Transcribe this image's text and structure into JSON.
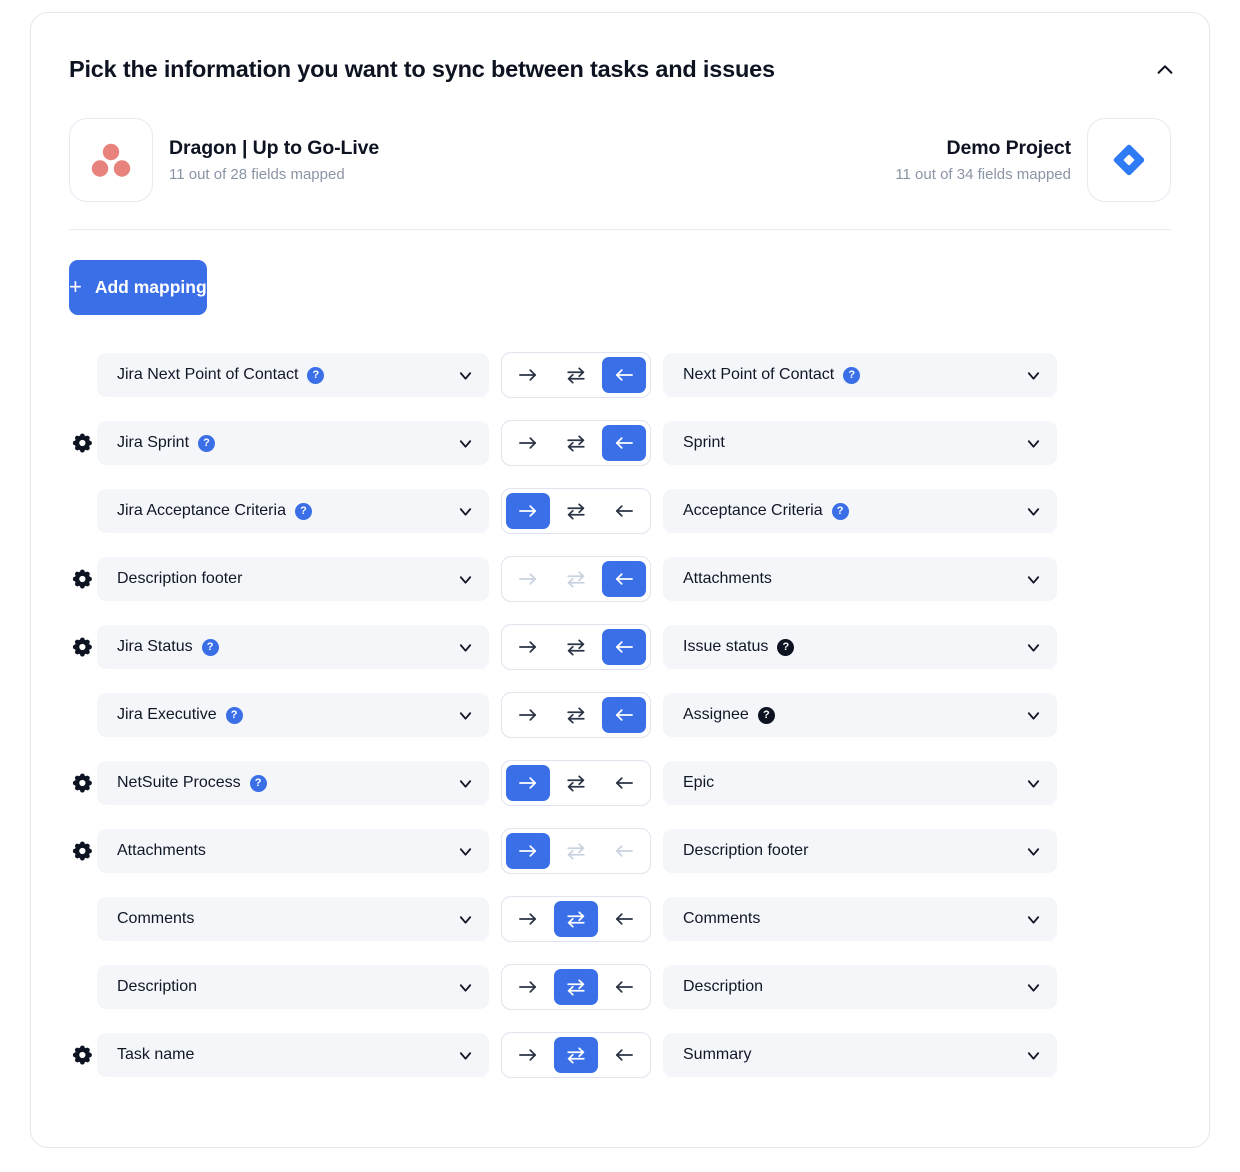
{
  "header": {
    "title": "Pick the information you want to sync between tasks and issues",
    "collapse_icon": "chevron-up-icon"
  },
  "apps": {
    "left": {
      "logo": "asana-logo",
      "name": "Dragon | Up to Go-Live",
      "fields_mapped": "11 out of 28 fields mapped"
    },
    "right": {
      "logo": "jira-logo",
      "name": "Demo Project",
      "fields_mapped": "11 out of 34 fields mapped"
    }
  },
  "toolbar": {
    "add_mapping_label": "Add mapping",
    "add_mapping_plus": "+"
  },
  "colors": {
    "accent": "#3b6fe8",
    "field_bg": "#f4f6f9",
    "badge_dark": "#0d1321",
    "asana_dot": "#e8827c",
    "jira_blue": "#2f7af5"
  },
  "mappings": [
    {
      "gear": false,
      "left": {
        "label": "Jira Next Point of Contact",
        "badge": "blue"
      },
      "direction": "left",
      "states": {
        "right_arrow": "normal",
        "swap": "normal",
        "left_arrow": "active"
      },
      "right": {
        "label": "Next Point of Contact",
        "badge": "blue"
      }
    },
    {
      "gear": true,
      "left": {
        "label": "Jira Sprint",
        "badge": "blue"
      },
      "direction": "left",
      "states": {
        "right_arrow": "normal",
        "swap": "normal",
        "left_arrow": "active"
      },
      "right": {
        "label": "Sprint",
        "badge": "none"
      }
    },
    {
      "gear": false,
      "left": {
        "label": "Jira Acceptance Criteria",
        "badge": "blue"
      },
      "direction": "right",
      "states": {
        "right_arrow": "active",
        "swap": "normal",
        "left_arrow": "normal"
      },
      "right": {
        "label": "Acceptance Criteria",
        "badge": "blue"
      }
    },
    {
      "gear": true,
      "left": {
        "label": "Description footer",
        "badge": "none"
      },
      "direction": "left",
      "states": {
        "right_arrow": "disabled",
        "swap": "disabled",
        "left_arrow": "active"
      },
      "right": {
        "label": "Attachments",
        "badge": "none"
      }
    },
    {
      "gear": true,
      "left": {
        "label": "Jira Status",
        "badge": "blue"
      },
      "direction": "left",
      "states": {
        "right_arrow": "normal",
        "swap": "normal",
        "left_arrow": "active"
      },
      "right": {
        "label": "Issue status",
        "badge": "dark"
      }
    },
    {
      "gear": false,
      "left": {
        "label": "Jira Executive",
        "badge": "blue"
      },
      "direction": "left",
      "states": {
        "right_arrow": "normal",
        "swap": "normal",
        "left_arrow": "active"
      },
      "right": {
        "label": "Assignee",
        "badge": "dark"
      }
    },
    {
      "gear": true,
      "left": {
        "label": "NetSuite Process",
        "badge": "blue"
      },
      "direction": "right",
      "states": {
        "right_arrow": "active",
        "swap": "normal",
        "left_arrow": "normal"
      },
      "right": {
        "label": "Epic",
        "badge": "none"
      }
    },
    {
      "gear": true,
      "left": {
        "label": "Attachments",
        "badge": "none"
      },
      "direction": "right",
      "states": {
        "right_arrow": "active",
        "swap": "disabled",
        "left_arrow": "disabled"
      },
      "right": {
        "label": "Description footer",
        "badge": "none"
      }
    },
    {
      "gear": false,
      "left": {
        "label": "Comments",
        "badge": "none"
      },
      "direction": "both",
      "states": {
        "right_arrow": "normal",
        "swap": "active",
        "left_arrow": "normal"
      },
      "right": {
        "label": "Comments",
        "badge": "none"
      }
    },
    {
      "gear": false,
      "left": {
        "label": "Description",
        "badge": "none"
      },
      "direction": "both",
      "states": {
        "right_arrow": "normal",
        "swap": "active",
        "left_arrow": "normal"
      },
      "right": {
        "label": "Description",
        "badge": "none"
      }
    },
    {
      "gear": true,
      "left": {
        "label": "Task name",
        "badge": "none"
      },
      "direction": "both",
      "states": {
        "right_arrow": "normal",
        "swap": "active",
        "left_arrow": "normal"
      },
      "right": {
        "label": "Summary",
        "badge": "none"
      }
    }
  ],
  "icons": {
    "gear": "gear-icon",
    "chevron_down": "chevron-down-icon",
    "arrow_right": "arrow-right-icon",
    "arrow_left": "arrow-left-icon",
    "swap": "swap-horizontal-icon"
  }
}
